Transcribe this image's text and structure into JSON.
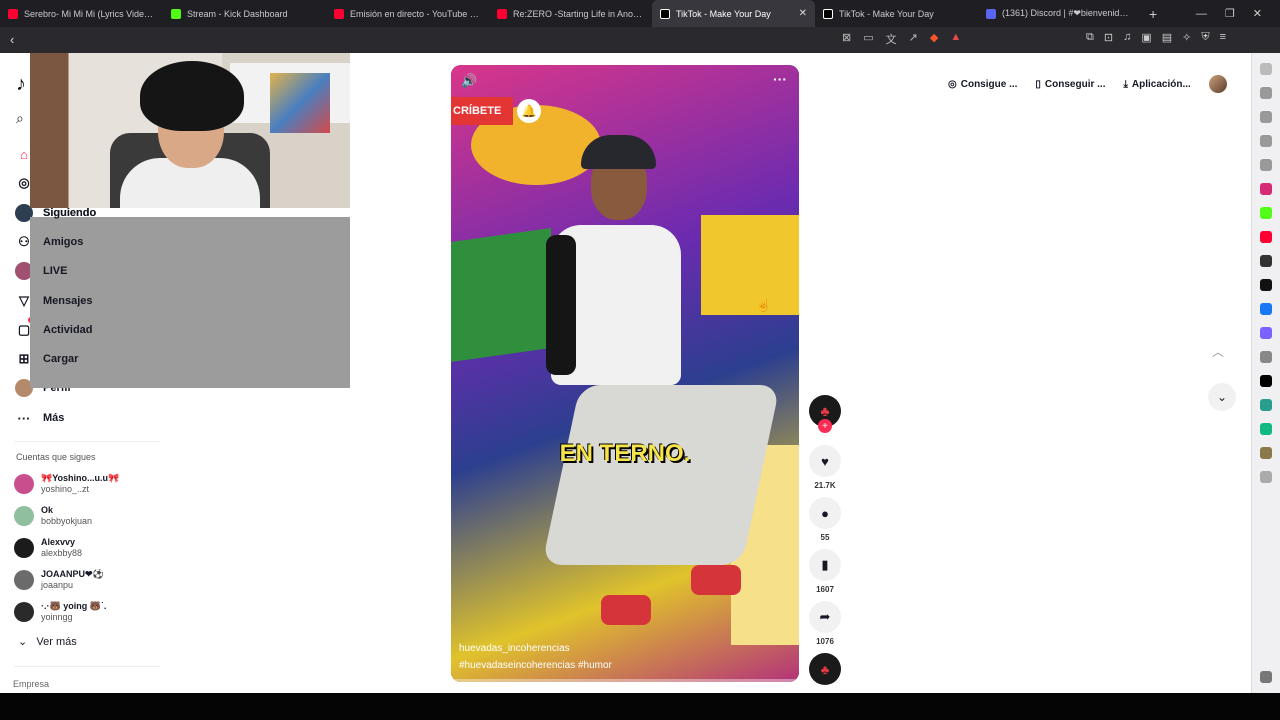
{
  "browser": {
    "tabs": [
      {
        "title": "Serebro- Mi Mi Mi (Lyrics Video) - Yo",
        "color": "#ff0033"
      },
      {
        "title": "Stream - Kick Dashboard",
        "color": "#53fc18"
      },
      {
        "title": "Emisión en directo - YouTube Studio",
        "color": "#ff0033"
      },
      {
        "title": "Re:ZERO -Starting Life in Another W",
        "color": "#ff0033"
      },
      {
        "title": "TikTok - Make Your Day",
        "color": "#ffffff",
        "active": true
      },
      {
        "title": "TikTok - Make Your Day",
        "color": "#ffffff"
      },
      {
        "title": "(1361) Discord | #❤bienvenido✌ | E",
        "color": "#5865f2"
      }
    ],
    "new_tab": "+",
    "close": "✕"
  },
  "sidebar": {
    "logo": "♪",
    "nav": [
      {
        "label": "Siguiendo",
        "icon": "following-icon"
      },
      {
        "label": "Amigos",
        "icon": "friends-icon"
      },
      {
        "label": "LIVE",
        "icon": "live-icon"
      },
      {
        "label": "Mensajes",
        "icon": "messages-icon"
      },
      {
        "label": "Actividad",
        "icon": "activity-icon",
        "badge": "4"
      },
      {
        "label": "Cargar",
        "icon": "upload-icon"
      },
      {
        "label": "Perfil",
        "icon": "profile-icon"
      },
      {
        "label": "Más",
        "icon": "more-icon"
      }
    ],
    "following_title": "Cuentas que sigues",
    "following": [
      {
        "name": "🎀Yoshino...u.u🎀",
        "user": "yoshino_..zt",
        "color": "#c94e8e"
      },
      {
        "name": "Ok",
        "user": "bobbyokjuan",
        "color": "#8fbf9f"
      },
      {
        "name": "Alexvvy",
        "user": "alexbby88",
        "color": "#1b1b1b"
      },
      {
        "name": "JOAANPU❤⚽",
        "user": "joaanpu",
        "color": "#6b6b6b"
      },
      {
        "name": "·.·🐻 yoing 🐻˙.",
        "user": "yoinngg",
        "color": "#2a2a2a"
      }
    ],
    "see_more": "Ver más",
    "footer": "Empresa"
  },
  "video": {
    "subscribe": "CRÍBETE",
    "caption": "EN TERNO.",
    "author": "huevadas_incoherencias",
    "tags": "#huevadaseincoherencias #humor"
  },
  "actions": {
    "likes": "21.7K",
    "comments": "55",
    "saves": "1607",
    "shares": "1076"
  },
  "topbar": {
    "coins": "Consigue ...",
    "app": "Conseguir ...",
    "download": "Aplicación..."
  },
  "colors": {
    "accent": "#fe2c55"
  }
}
